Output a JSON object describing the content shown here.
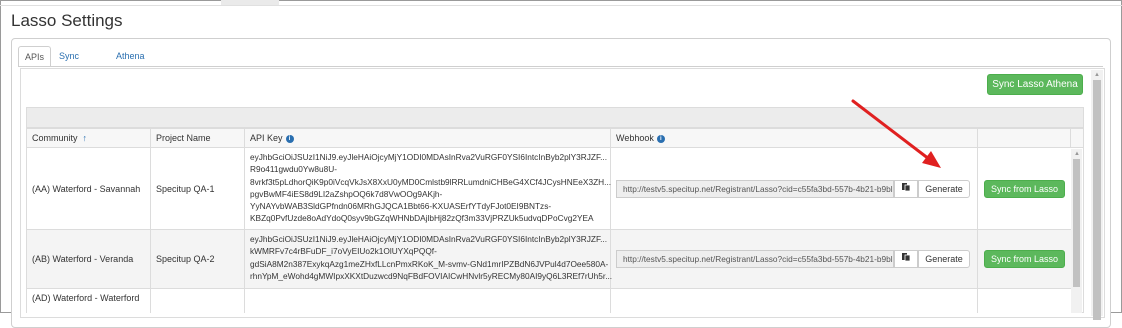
{
  "page": {
    "title": "Lasso Settings"
  },
  "tabs": [
    {
      "label": "APIs",
      "active": true
    },
    {
      "label": "Sync Logs",
      "active": false
    },
    {
      "label": "Athena Settings",
      "active": false
    }
  ],
  "toolbar": {
    "sync_athena_label": "Sync Lasso Athena"
  },
  "table": {
    "headers": {
      "community": "Community",
      "project_name": "Project Name",
      "api_key": "API Key",
      "webhook": "Webhook"
    },
    "rows": [
      {
        "community": "(AA) Waterford - Savannah",
        "project_name": "Specitup QA-1",
        "api_key_lines": [
          "eyJhbGciOiJSUzI1NiJ9.eyJleHAiOjcyMjY1ODI0MDAsInRva2VuRGF0YSI6IntcInByb2plY3RJZF...",
          "R9o411gwdu0Yw8u8U-",
          "8vrkf3t5pLdhorQiK9p0iVcqVkJsX8XxU0yMD0Cmlstb9lRRLumdniCHBeG4XCf4JCysHNEeX3ZH...",
          "pgvBwMF4iES8d9LI2aZshpOQ6k7d8VwOOg9AKjh-",
          "YyNAYvbWAB3SldGPfndn06MRhGJQCA1Bbt66-KXUASErfYTdyFJot0EI9BNTzs-",
          "KBZq0PvfUzde8oAdYdoQ0syv9bGZqWHNbDAjlbHj82zQf3m33VjPRZUk5udvqDPoCvg2YEA"
        ],
        "webhook": "http://testv5.specitup.net/Registrant/Lasso?cid=c55fa3bd-557b-4b21-b9bl",
        "generate_label": "Generate",
        "sync_label": "Sync from Lasso"
      },
      {
        "community": "(AB) Waterford - Veranda",
        "project_name": "Specitup QA-2",
        "api_key_lines": [
          "eyJhbGciOiJSUzI1NiJ9.eyJleHAiOjcyMjY1ODI0MDAsInRva2VuRGF0YSI6IntcInByb2plY3RJZF...",
          "kWMRFv7c4rBFuDF_i7oVyEIUo2k1OlUYXqPQQf-",
          "gdSiA8M2n387ExykqAzg1meZHxfLLcnPmxRKoK_M-svmv-GNd1mrIPZBdN6JVPul4d7Oee580A-",
          "rhnYpM_eWohd4gMWIpxXKXtDuzwcd9NqFBdFOVIAICwHNvlr5yRECMy80AI9yQ6L3REf7rUh5r..."
        ],
        "webhook": "http://testv5.specitup.net/Registrant/Lasso?cid=c55fa3bd-557b-4b21-b9bl",
        "generate_label": "Generate",
        "sync_label": "Sync from Lasso"
      },
      {
        "community": "(AD) Waterford - Waterford",
        "project_name": "",
        "api_key_lines": [],
        "webhook": "",
        "generate_label": "",
        "sync_label": ""
      }
    ]
  },
  "icons": {
    "sort": "sort-up-icon",
    "info": "info-icon",
    "copy": "clipboard-icon",
    "annotation": "red-arrow-annotation"
  },
  "colors": {
    "accent": "#2a6fb0",
    "success": "#5cb85c",
    "annotation": "#e02020"
  }
}
